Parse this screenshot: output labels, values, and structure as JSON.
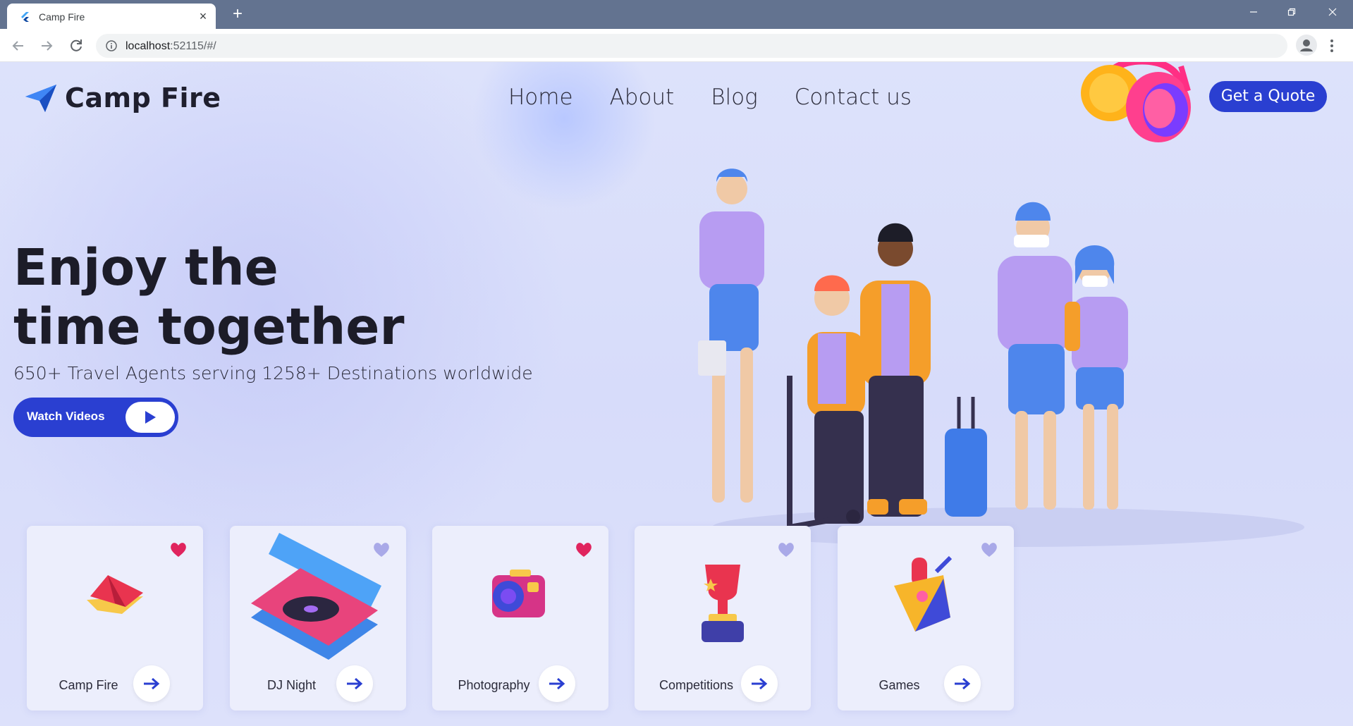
{
  "browser": {
    "tab_title": "Camp Fire",
    "tab_close": "×",
    "new_tab": "+",
    "url_host": "localhost",
    "url_rest": ":52115/#/"
  },
  "header": {
    "brand": "Camp Fire",
    "nav": [
      "Home",
      "About",
      "Blog",
      "Contact us"
    ],
    "cta": "Get a Quote"
  },
  "hero": {
    "title_line1": "Enjoy the",
    "title_line2": "time together",
    "subtitle": "650+ Travel Agents serving 1258+ Destinations worldwide",
    "watch_label": "Watch Videos"
  },
  "cards": [
    {
      "label": "Camp Fire",
      "favorited": true
    },
    {
      "label": "DJ Night",
      "favorited": false
    },
    {
      "label": "Photography",
      "favorited": true
    },
    {
      "label": "Competitions",
      "favorited": false
    },
    {
      "label": "Games",
      "favorited": false
    }
  ],
  "colors": {
    "accent": "#2a3fd1",
    "heart_on": "#e0245e",
    "heart_off": "#a9a9e8"
  }
}
